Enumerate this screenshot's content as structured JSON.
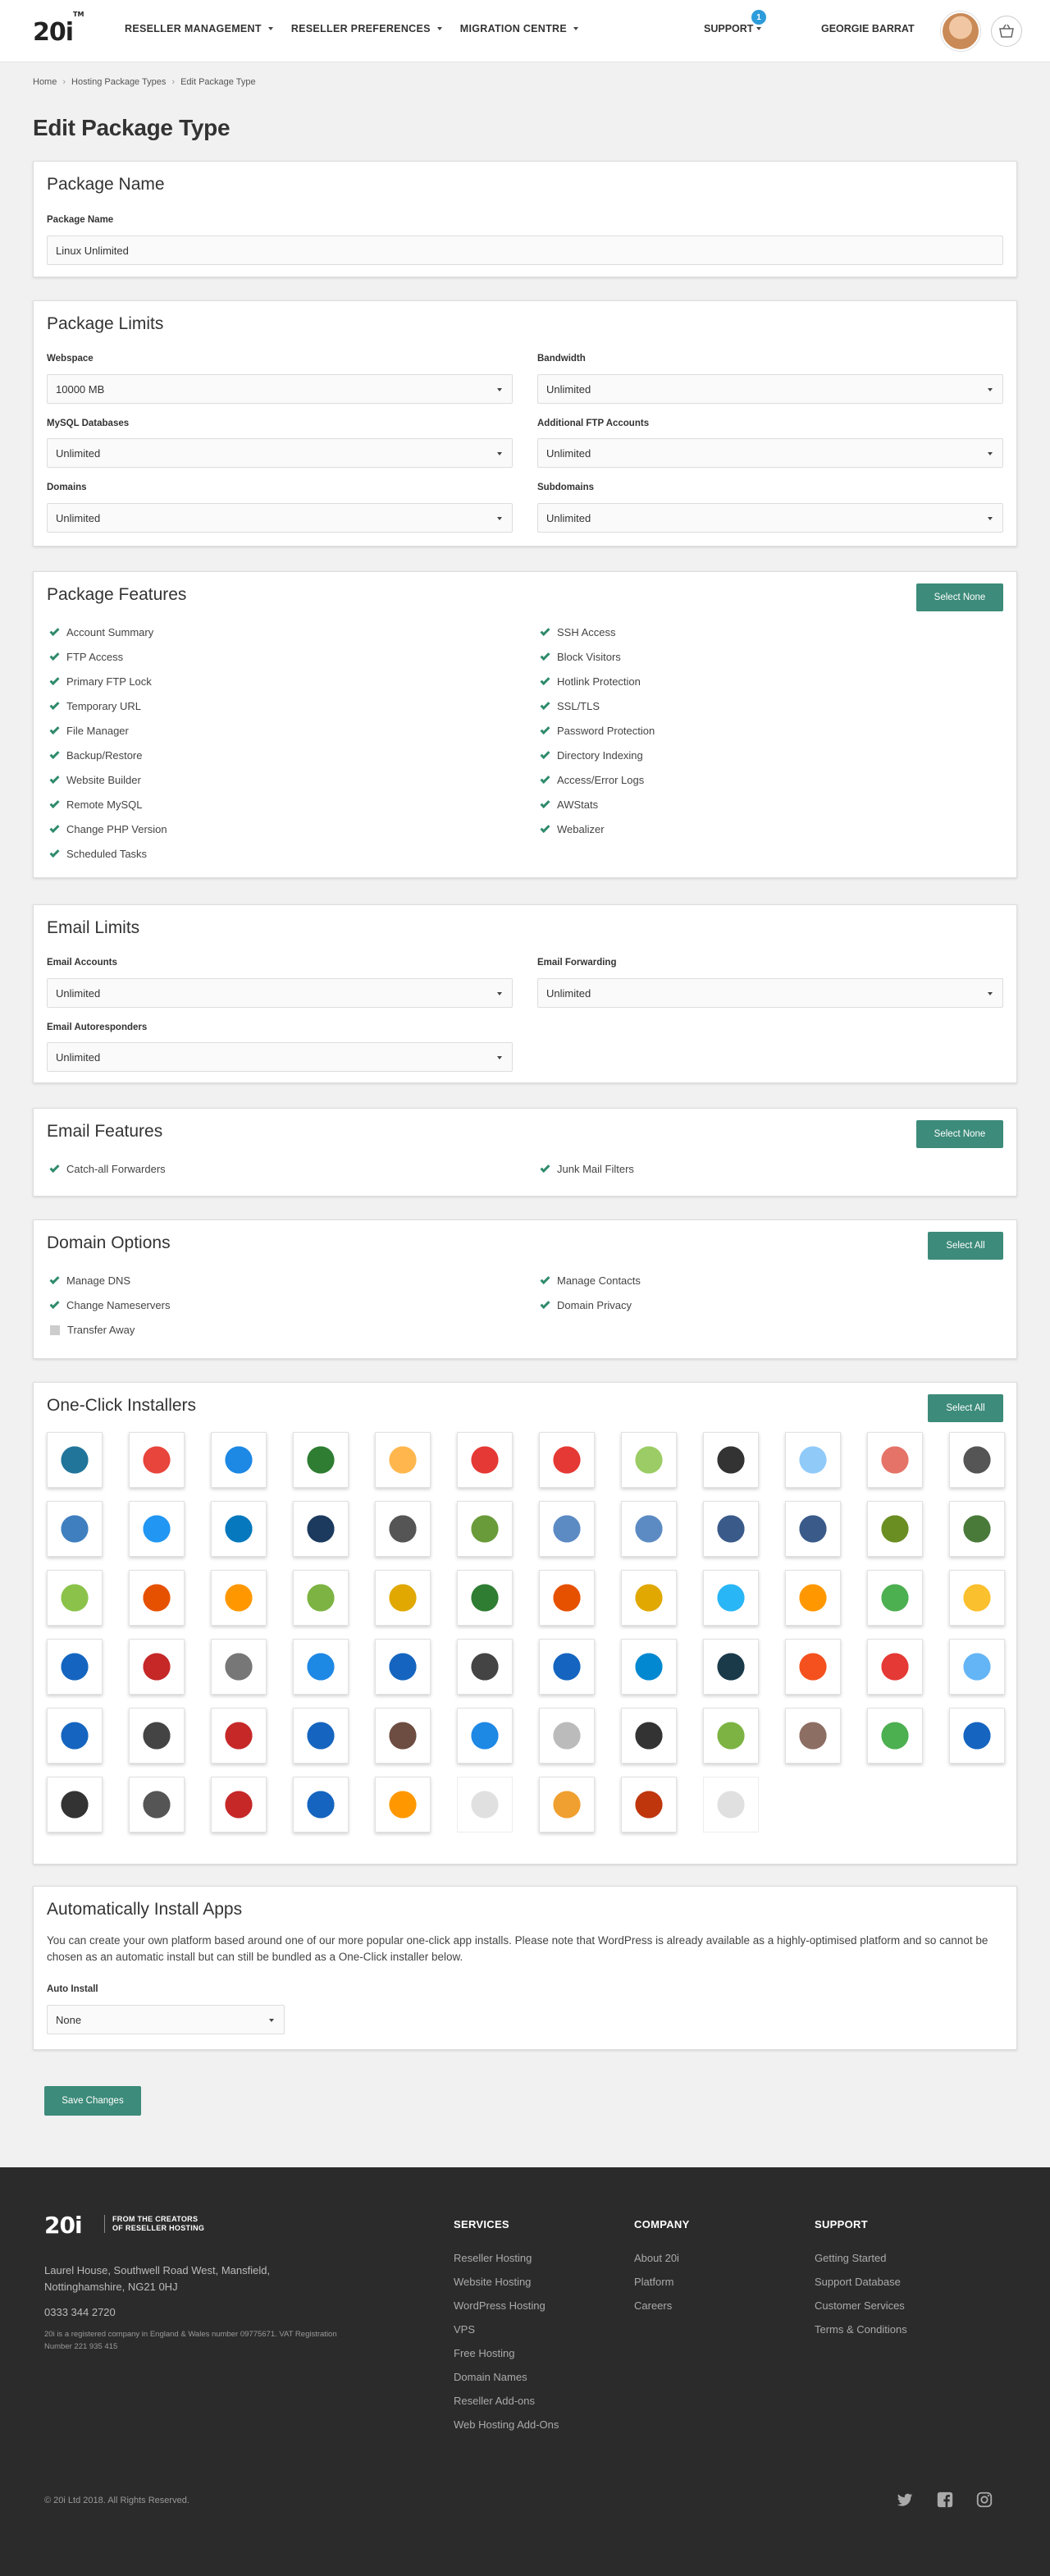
{
  "header": {
    "logo": "20i",
    "logo_tm": "TM",
    "nav": [
      "RESELLER MANAGEMENT",
      "RESELLER PREFERENCES",
      "MIGRATION CENTRE"
    ],
    "support_label": "SUPPORT",
    "support_badge": "1",
    "user_name": "GEORGIE BARRAT"
  },
  "breadcrumb": [
    "Home",
    "Hosting Package Types",
    "Edit Package Type"
  ],
  "page_title": "Edit Package Type",
  "package_name": {
    "heading": "Package Name",
    "label": "Package Name",
    "value": "Linux Unlimited"
  },
  "package_limits": {
    "heading": "Package Limits",
    "fields": [
      {
        "label": "Webspace",
        "value": "10000 MB"
      },
      {
        "label": "Bandwidth",
        "value": "Unlimited"
      },
      {
        "label": "MySQL Databases",
        "value": "Unlimited"
      },
      {
        "label": "Additional FTP Accounts",
        "value": "Unlimited"
      },
      {
        "label": "Domains",
        "value": "Unlimited"
      },
      {
        "label": "Subdomains",
        "value": "Unlimited"
      }
    ]
  },
  "package_features": {
    "heading": "Package Features",
    "button": "Select None",
    "left": [
      "Account Summary",
      "FTP Access",
      "Primary FTP Lock",
      "Temporary URL",
      "File Manager",
      "Backup/Restore",
      "Website Builder",
      "Remote MySQL",
      "Change PHP Version",
      "Scheduled Tasks"
    ],
    "right": [
      "SSH Access",
      "Block Visitors",
      "Hotlink Protection",
      "SSL/TLS",
      "Password Protection",
      "Directory Indexing",
      "Access/Error Logs",
      "AWStats",
      "Webalizer"
    ]
  },
  "email_limits": {
    "heading": "Email Limits",
    "fields": [
      {
        "label": "Email Accounts",
        "value": "Unlimited"
      },
      {
        "label": "Email Forwarding",
        "value": "Unlimited"
      },
      {
        "label": "Email Autoresponders",
        "value": "Unlimited"
      }
    ]
  },
  "email_features": {
    "heading": "Email Features",
    "button": "Select None",
    "items": [
      "Catch-all Forwarders",
      "Junk Mail Filters"
    ]
  },
  "domain_options": {
    "heading": "Domain Options",
    "button": "Select All",
    "items": [
      {
        "label": "Manage DNS",
        "checked": true
      },
      {
        "label": "Manage Contacts",
        "checked": true
      },
      {
        "label": "Change Nameservers",
        "checked": true
      },
      {
        "label": "Domain Privacy",
        "checked": true
      },
      {
        "label": "Transfer Away",
        "checked": false
      }
    ]
  },
  "installers": {
    "heading": "One-Click Installers",
    "button": "Select All",
    "app_colors": [
      "#21759b",
      "#e8453c",
      "#1e88e5",
      "#2e7d32",
      "#ffb74d",
      "#e53935",
      "#e53935",
      "#9ccc65",
      "#333333",
      "#90caf9",
      "#e57368",
      "#555555",
      "#3f7fbf",
      "#2196f3",
      "#0678be",
      "#1c3a5e",
      "#555555",
      "#6a9b3a",
      "#5c8bc4",
      "#5c8bc4",
      "#3a5a8a",
      "#3a5a8a",
      "#6b8e23",
      "#4a7a3a",
      "#8bc34a",
      "#e65100",
      "#ff9800",
      "#7cb342",
      "#e0a800",
      "#2e7d32",
      "#e65100",
      "#e0a800",
      "#29b6f6",
      "#ff9800",
      "#4caf50",
      "#fbc02d",
      "#1565c0",
      "#c62828",
      "#777777",
      "#1e88e5",
      "#1565c0",
      "#444444",
      "#1565c0",
      "#0288d1",
      "#1a3a4a",
      "#f4511e",
      "#e53935",
      "#64b5f6",
      "#1565c0",
      "#444444",
      "#c62828",
      "#1565c0",
      "#6d4c41",
      "#1e88e5",
      "#bbbbbb",
      "#333333",
      "#7cb342",
      "#8d6e63",
      "#4caf50",
      "#1565c0",
      "#333333",
      "#555555",
      "#c62828",
      "#1565c0",
      "#ff9800",
      "#cccccc",
      "#f0a030",
      "#bf360c",
      "#cccccc"
    ],
    "dim_indexes": [
      65,
      68
    ]
  },
  "auto_install": {
    "heading": "Automatically Install Apps",
    "text": "You can create your own platform based around one of our more popular one-click app installs. Please note that WordPress is already available as a highly-optimised platform and so cannot be chosen as an automatic install but can still be bundled as a One-Click installer below.",
    "label": "Auto Install",
    "value": "None"
  },
  "save_button": "Save Changes",
  "footer": {
    "logo": "20i",
    "tagline": "FROM THE CREATORS OF RESELLER HOSTING",
    "address": "Laurel House, Southwell Road West, Mansfield, Nottinghamshire, NG21 0HJ",
    "phone": "0333 344 2720",
    "legal": "20i is a registered company in England & Wales number 09775671. VAT Registration Number 221 935 415",
    "columns": [
      {
        "title": "SERVICES",
        "links": [
          "Reseller Hosting",
          "Website Hosting",
          "WordPress Hosting",
          "VPS",
          "Free Hosting",
          "Domain Names",
          "Reseller Add-ons",
          "Web Hosting Add-Ons"
        ]
      },
      {
        "title": "COMPANY",
        "links": [
          "About 20i",
          "Platform",
          "Careers"
        ]
      },
      {
        "title": "SUPPORT",
        "links": [
          "Getting Started",
          "Support Database",
          "Customer Services",
          "Terms & Conditions"
        ]
      }
    ],
    "copyright": "© 20i Ltd 2018. All Rights Reserved.",
    "social": [
      "twitter-icon",
      "facebook-icon",
      "instagram-icon"
    ]
  }
}
